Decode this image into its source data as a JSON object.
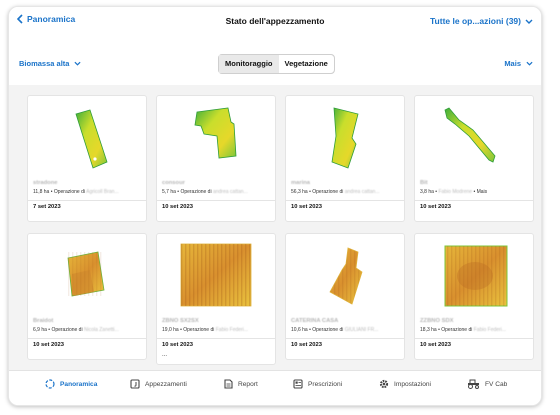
{
  "header": {
    "back_label": "Panoramica",
    "title": "Stato dell'appezzamento",
    "right_link": "Tutte le op...azioni (39)"
  },
  "filters": {
    "layer": "Biomassa alta",
    "segments": [
      "Monitoraggio",
      "Vegetazione"
    ],
    "active_segment": "Monitoraggio",
    "crop": "Mais"
  },
  "fields": [
    {
      "name": "stradone",
      "area": "11,8 ha",
      "ops": "Operazione di",
      "owner": "Agricoll Bran...",
      "date": "7 set 2023"
    },
    {
      "name": "consour",
      "area": "5,7 ha",
      "ops": "Operazione di",
      "owner": "andrea cattan...",
      "date": "10 set 2023"
    },
    {
      "name": "marina",
      "area": "56,3 ha",
      "ops": "Operazione di",
      "owner": "andrea cattan...",
      "date": "10 set 2023"
    },
    {
      "name": "Bit",
      "area": "3,8 ha",
      "ops": "",
      "owner": "Fabio Modrene",
      "extra": "Mais",
      "date": "10 set 2023"
    },
    {
      "name": "Braidot",
      "area": "6,9 ha",
      "ops": "Operazione di",
      "owner": "Nicola Zanetti...",
      "date": "10 set 2023"
    },
    {
      "name": "ZBNO SX2SX",
      "area": "19,0 ha",
      "ops": "Operazione di",
      "owner": "Fabio Federi...",
      "date": "10 set 2023",
      "more": "..."
    },
    {
      "name": "CATERINA CASA",
      "area": "10,6 ha",
      "ops": "Operazione di",
      "owner": "GIULIANI FR...",
      "date": "10 set 2023"
    },
    {
      "name": "ZZBNO SDX",
      "area": "18,3 ha",
      "ops": "Operazione di",
      "owner": "Fabio Federi...",
      "date": "10 set 2023"
    }
  ],
  "tabs": [
    {
      "label": "Panoramica",
      "icon": "overview-icon",
      "active": true
    },
    {
      "label": "Appezzamenti",
      "icon": "field-book-icon",
      "active": false
    },
    {
      "label": "Report",
      "icon": "document-icon",
      "active": false
    },
    {
      "label": "Prescrizioni",
      "icon": "prescription-icon",
      "active": false
    },
    {
      "label": "Impostazioni",
      "icon": "gear-icon",
      "active": false
    },
    {
      "label": "FV Cab",
      "icon": "tractor-icon",
      "active": false
    }
  ],
  "colors": {
    "accent": "#1a73c9",
    "background": "#f3f3f3"
  }
}
